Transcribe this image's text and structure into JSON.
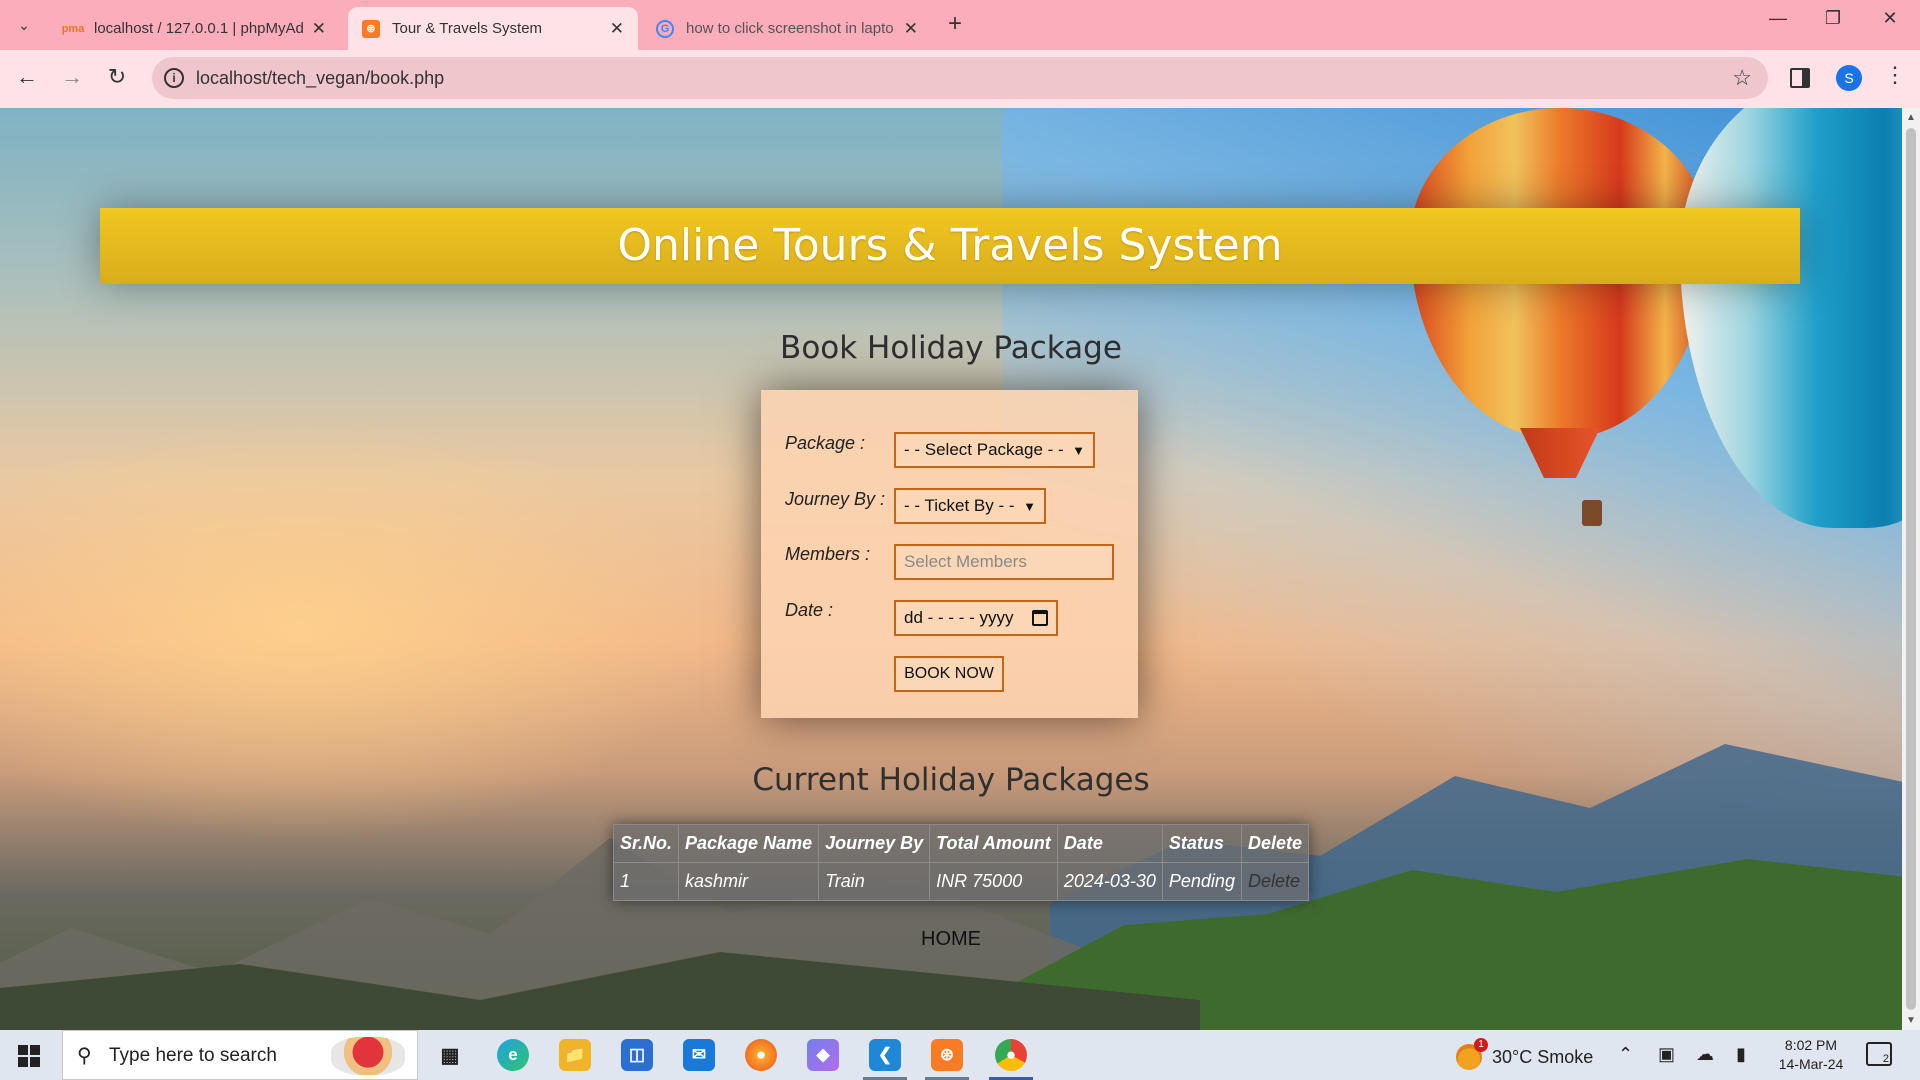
{
  "browser": {
    "tabs": [
      {
        "title": "localhost / 127.0.0.1 | phpMyAd",
        "favicon": "phpmyadmin-icon",
        "active": false
      },
      {
        "title": "Tour & Travels System",
        "favicon": "xampp-icon",
        "active": true
      },
      {
        "title": "how to click screenshot in lapto",
        "favicon": "google-icon",
        "active": false
      }
    ],
    "url": "localhost/tech_vegan/book.php",
    "profile_initial": "S"
  },
  "page": {
    "site_title": "Online Tours & Travels System",
    "book_heading": "Book Holiday Package",
    "form": {
      "package_label": "Package :",
      "package_value": "- - Select Package - -",
      "journey_label": "Journey By :",
      "journey_value": "- - Ticket By - -",
      "members_label": "Members :",
      "members_placeholder": "Select Members",
      "date_label": "Date :",
      "date_value": "dd - - - - - yyyy",
      "submit_label": "BOOK NOW"
    },
    "current_heading": "Current Holiday Packages",
    "table": {
      "headers": [
        "Sr.No.",
        "Package Name",
        "Journey By",
        "Total Amount",
        "Date",
        "Status",
        "Delete"
      ],
      "rows": [
        [
          "1",
          "kashmir",
          "Train",
          "INR 75000",
          "2024-03-30",
          "Pending",
          "Delete"
        ]
      ]
    },
    "home_link": "HOME"
  },
  "taskbar": {
    "search_placeholder": "Type here to search",
    "weather_temp": "30°C",
    "weather_desc": "Smoke",
    "weather_badge": "1",
    "time": "8:02 PM",
    "date": "14-Mar-24",
    "notification_count": "2"
  }
}
